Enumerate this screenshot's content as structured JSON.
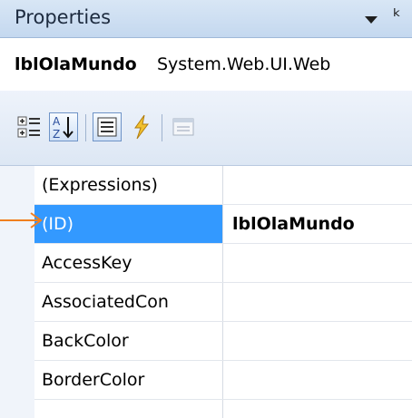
{
  "titlebar": {
    "title": "Properties"
  },
  "object_selector": {
    "name": "lblOlaMundo",
    "type": "System.Web.UI.Web"
  },
  "toolbar": {
    "buttons": [
      {
        "icon": "categorized-icon",
        "active": false
      },
      {
        "icon": "alphabetical-icon",
        "active": true
      },
      {
        "icon": "properties-icon",
        "active": true
      },
      {
        "icon": "events-icon",
        "active": false
      },
      {
        "icon": "property-pages-icon",
        "active": false
      }
    ]
  },
  "rows": [
    {
      "name": "(Expressions)",
      "value": ""
    },
    {
      "name": "(ID)",
      "value": "lblOlaMundo",
      "selected": true
    },
    {
      "name": "AccessKey",
      "value": ""
    },
    {
      "name": "AssociatedCon",
      "value": ""
    },
    {
      "name": "BackColor",
      "value": ""
    },
    {
      "name": "BorderColor",
      "value": ""
    },
    {
      "name": "",
      "value": ""
    }
  ],
  "colors": {
    "selection": "#3399ff",
    "annotation_arrow": "#f07f1e",
    "titlebar": "#c4d8ef"
  }
}
